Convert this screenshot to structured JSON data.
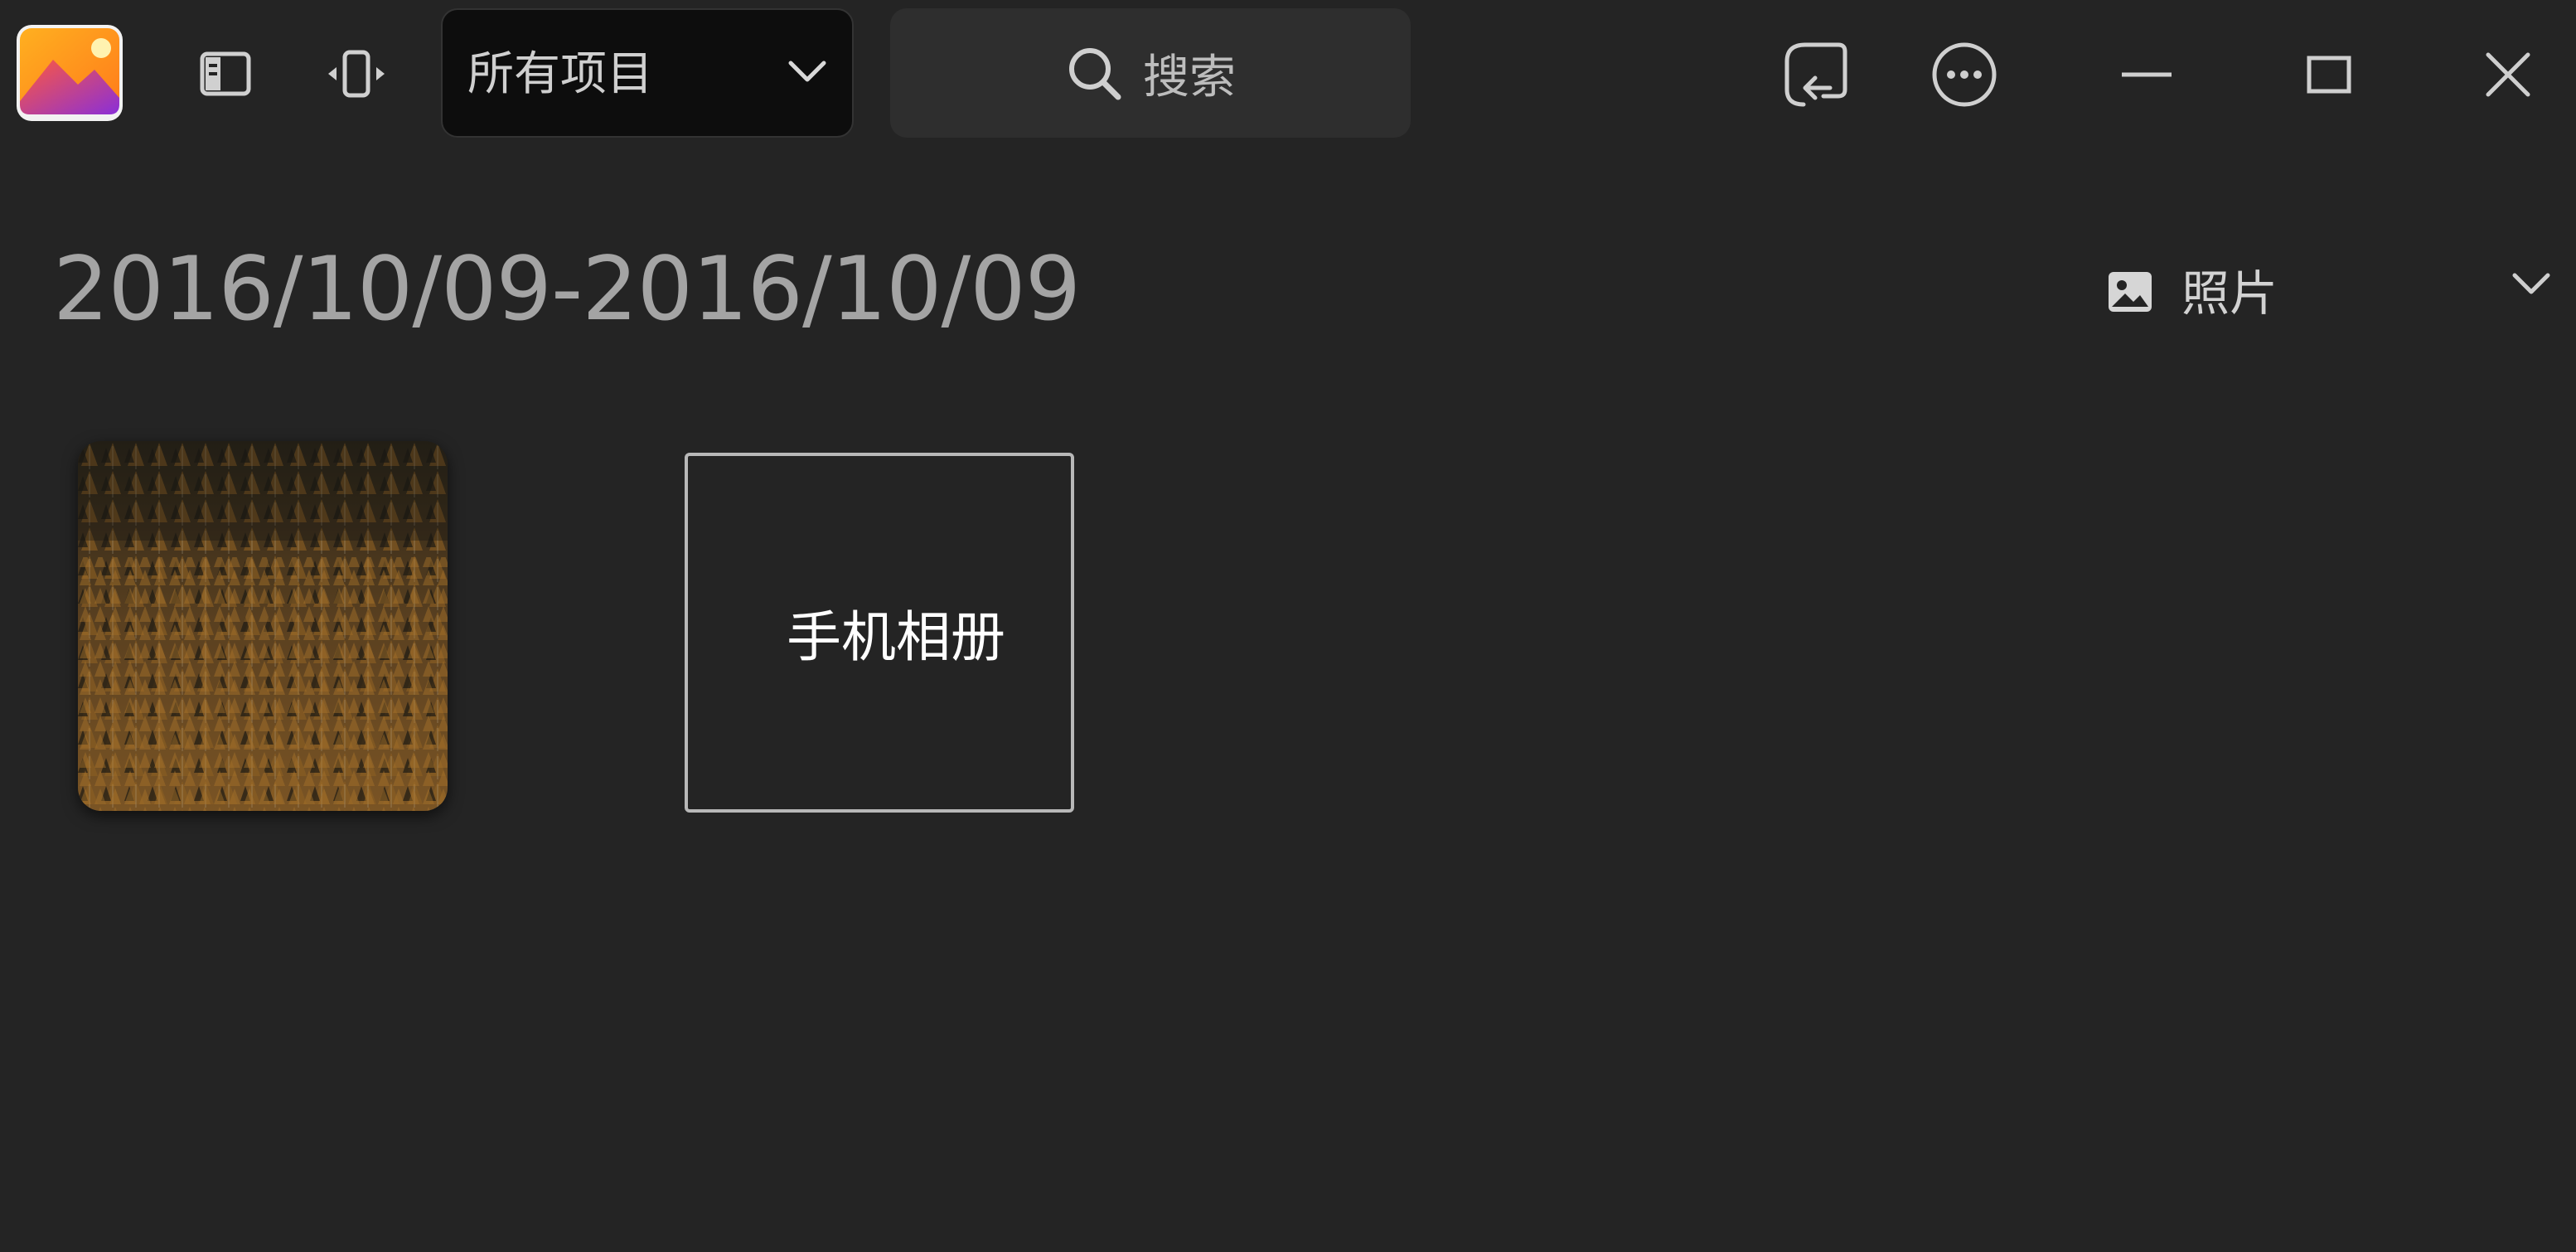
{
  "titlebar": {
    "filter": {
      "selected": "所有项目"
    },
    "search": {
      "label": "搜索"
    }
  },
  "header": {
    "date_range": "2016/10/09-2016/10/09",
    "view_mode": "照片"
  },
  "content": {
    "album_label": "手机相册"
  },
  "icons": {
    "app_logo": "photo-app-logo",
    "sidebar_toggle": "sidebar-toggle-icon",
    "fit_toggle": "fit-width-icon",
    "search": "search-icon",
    "import": "import-icon",
    "more": "more-options-icon",
    "minimize": "minimize-icon",
    "maximize": "maximize-icon",
    "close": "close-icon",
    "photo": "photo-icon",
    "chevron": "chevron-down-icon"
  },
  "colors": {
    "background": "#242424",
    "filter_bg": "#0d0d0d",
    "search_bg": "#2e2e2e",
    "card_border": "#b8b8b8"
  }
}
